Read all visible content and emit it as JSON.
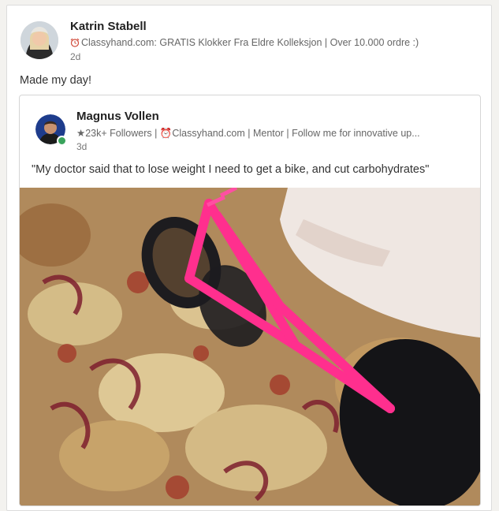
{
  "post": {
    "author_name": "Katrin Stabell",
    "author_tagline": "Classyhand.com: GRATIS Klokker Fra Eldre Kolleksjon | Over 10.000 ordre :)",
    "time": "2d",
    "text": "Made my day!"
  },
  "shared": {
    "author_name": "Magnus Vollen",
    "author_tagline": "★23k+ Followers | ⏰Classyhand.com | Mentor | Follow me for innovative up...",
    "time": "3d",
    "text": "\"My doctor said that to lose weight I need to get a bike, and cut carbohydrates\""
  },
  "colors": {
    "bike": "#ff2f8e",
    "online": "#3aa35c"
  },
  "icons": {
    "clock": "alarm-clock-icon"
  }
}
